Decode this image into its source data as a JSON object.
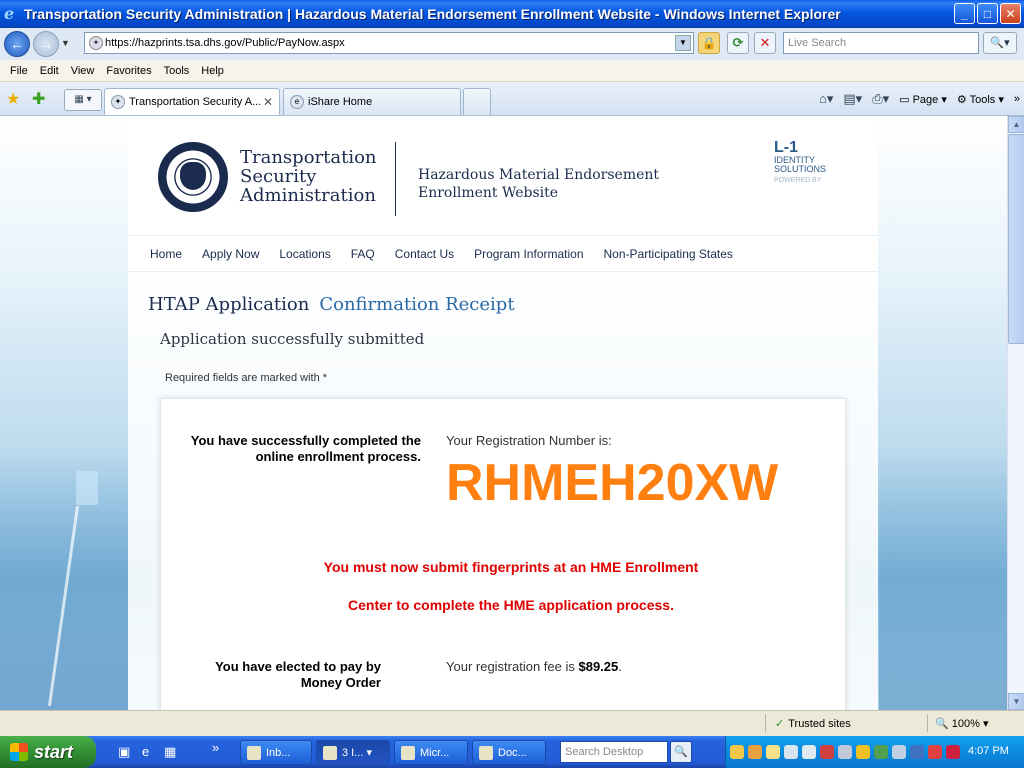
{
  "window": {
    "title": "Transportation Security Administration | Hazardous Material Endorsement Enrollment Website - Windows Internet Explorer",
    "min_label": "_",
    "max_label": "□",
    "close_label": "✕"
  },
  "address": {
    "url": "https://hazprints.tsa.dhs.gov/Public/PayNow.aspx",
    "search_placeholder": "Live Search"
  },
  "menu": {
    "items": [
      "File",
      "Edit",
      "View",
      "Favorites",
      "Tools",
      "Help"
    ]
  },
  "tabs": [
    {
      "label": "Transportation Security A...",
      "close": "✕"
    },
    {
      "label": "iShare Home"
    }
  ],
  "commandbar": {
    "page_label": "Page",
    "tools_label": "Tools"
  },
  "site": {
    "agency_lines": [
      "Transportation",
      "Security",
      "Administration"
    ],
    "site_name_lines": [
      "Hazardous Material Endorsement",
      "Enrollment Website"
    ],
    "partner_logo": {
      "line1": "L-1",
      "line2": "IDENTITY",
      "line3": "SOLUTIONS",
      "powered": "POWERED BY"
    },
    "nav": [
      "Home",
      "Apply Now",
      "Locations",
      "FAQ",
      "Contact Us",
      "Program Information",
      "Non-Participating States"
    ]
  },
  "content": {
    "heading": "HTAP Application",
    "subheading": "Confirmation Receipt",
    "success": "Application successfully submitted",
    "required_note": "Required fields are marked with *",
    "left_message": "You have successfully completed the online enrollment process.",
    "reg_label": "Your Registration Number is:",
    "reg_number": "RHMEH20XW",
    "warning_line1": "You must now submit fingerprints at an HME Enrollment",
    "warning_line2": "Center to complete the HME application process.",
    "pay_message": "You have elected to pay by Money Order",
    "fee_label": "Your registration fee is ",
    "fee_amount": "$89.25",
    "fee_suffix": "."
  },
  "statusbar": {
    "zone": "Trusted sites",
    "zoom": "100%"
  },
  "taskbar": {
    "start_label": "start",
    "buttons": [
      "Inb...",
      "3 I...",
      "Micr...",
      "Doc..."
    ],
    "desktop_search_placeholder": "Search Desktop",
    "clock": "4:07 PM"
  },
  "colors": {
    "reg_number": "#ff8010",
    "warning": "#e00000",
    "brand_navy": "#1b2b4d",
    "link_blue": "#2a6aa6"
  }
}
